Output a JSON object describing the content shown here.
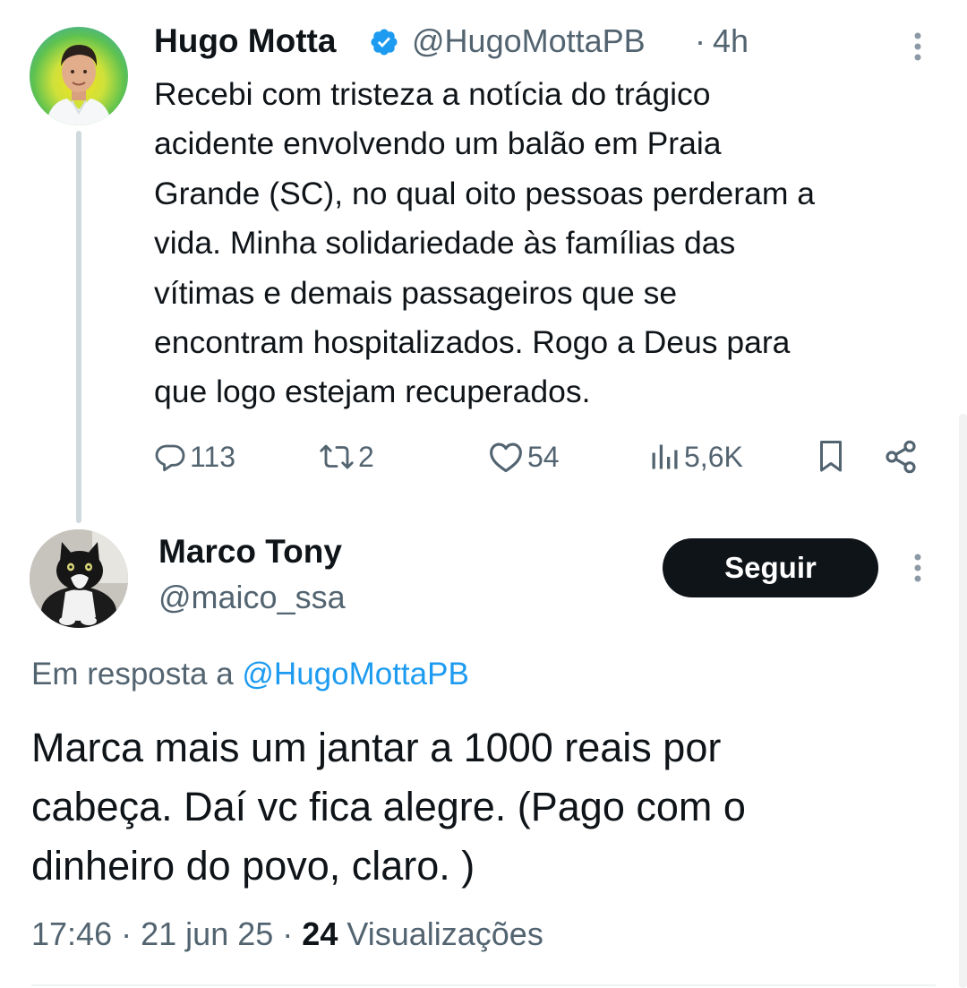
{
  "parent_tweet": {
    "author_name": "Hugo Motta",
    "verified_icon": "verified-badge-icon",
    "handle": "@HugoMottaPB",
    "separator": "·",
    "time": "4h",
    "text_lines": [
      "Recebi com tristeza a notícia do trágico",
      "acidente envolvendo um balão em Praia",
      "Grande (SC), no qual oito pessoas perderam a",
      "vida. Minha solidariedade às famílias das",
      "vítimas e demais passageiros que se",
      "encontram hospitalizados. Rogo a Deus para",
      "que logo estejam recuperados."
    ],
    "actions": {
      "replies": "113",
      "reposts": "2",
      "likes": "54",
      "views": "5,6K"
    }
  },
  "reply_tweet": {
    "author_name": "Marco Tony",
    "handle": "@maico_ssa",
    "follow_label": "Seguir",
    "reply_context_prefix": "Em resposta a",
    "reply_context_mention": "@HugoMottaPB",
    "text_lines": [
      "Marca mais um jantar a 1000 reais por",
      "cabeça. Daí vc fica alegre. (Pago com o",
      "dinheiro do povo, claro. )"
    ],
    "time": "17:46",
    "separator": "·",
    "date": "21 jun 25",
    "views_count": "24",
    "views_label": "Visualizações"
  },
  "colors": {
    "text_primary": "#0f1419",
    "text_secondary": "#536471",
    "accent": "#1d9bf0",
    "button_bg": "#0f1419"
  }
}
